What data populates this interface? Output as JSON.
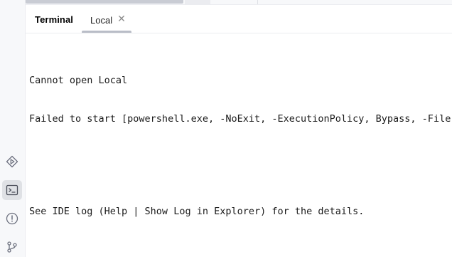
{
  "tool_window": {
    "title": "Terminal",
    "tabs": [
      {
        "label": "Local",
        "close_glyph": "✕"
      }
    ]
  },
  "terminal": {
    "lines": [
      "Cannot open Local",
      "Failed to start [powershell.exe, -NoExit, -ExecutionPolicy, Bypass, -File,",
      "See IDE log (Help | Show Log in Explorer) for the details."
    ]
  },
  "left_strip": {
    "icons": [
      "services-icon",
      "terminal-icon",
      "problems-icon",
      "git-icon"
    ],
    "active": "terminal-icon"
  },
  "colors": {
    "background": "#ffffff",
    "strip_background": "#f7f8fa",
    "tab_underline": "#b9bdc7",
    "icon": "#6c707e"
  }
}
